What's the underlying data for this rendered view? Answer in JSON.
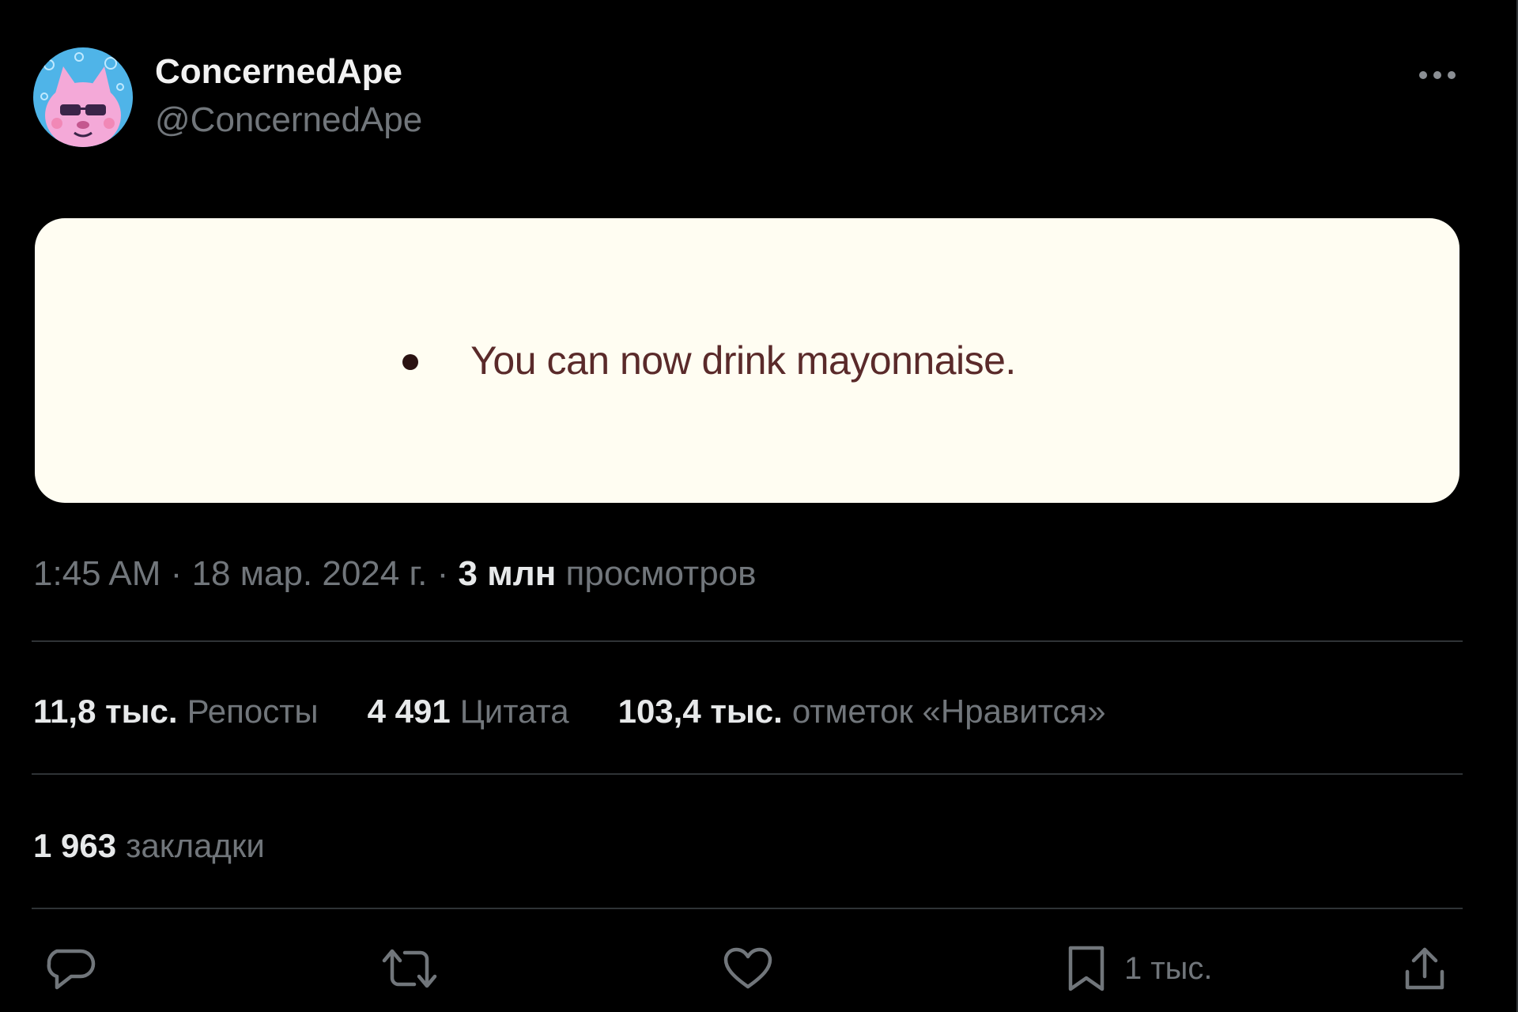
{
  "post": {
    "author": {
      "display_name": "ConcernedApe",
      "handle": "@ConcernedApe",
      "avatar_icon": "pink-cat-avatar"
    },
    "more_icon": "more-dots-icon",
    "media_text": "You can now drink mayonnaise.",
    "meta": {
      "time": "1:45 AM",
      "separator": "·",
      "date": "18 мар. 2024 г.",
      "views_count": "3 млн",
      "views_label": "просмотров"
    },
    "stats": {
      "reposts": {
        "count": "11,8 тыс.",
        "label": "Репосты"
      },
      "quotes": {
        "count": "4 491",
        "label": "Цитата"
      },
      "likes": {
        "count": "103,4 тыс.",
        "label": "отметок «Нравится»"
      }
    },
    "bookmarks": {
      "count": "1 963",
      "label": "закладки"
    },
    "actions": {
      "reply_icon": "reply-bubble-icon",
      "repost_icon": "repost-arrows-icon",
      "like_icon": "heart-icon",
      "bookmark_icon": "bookmark-icon",
      "bookmark_count": "1 тыс.",
      "share_icon": "share-upload-icon"
    }
  },
  "colors": {
    "background": "#000000",
    "primary_text": "#e7e9ea",
    "secondary_text": "#71767b",
    "divider": "#2f3336",
    "media_background": "#fffdf2",
    "media_text": "#5a2a2a"
  }
}
